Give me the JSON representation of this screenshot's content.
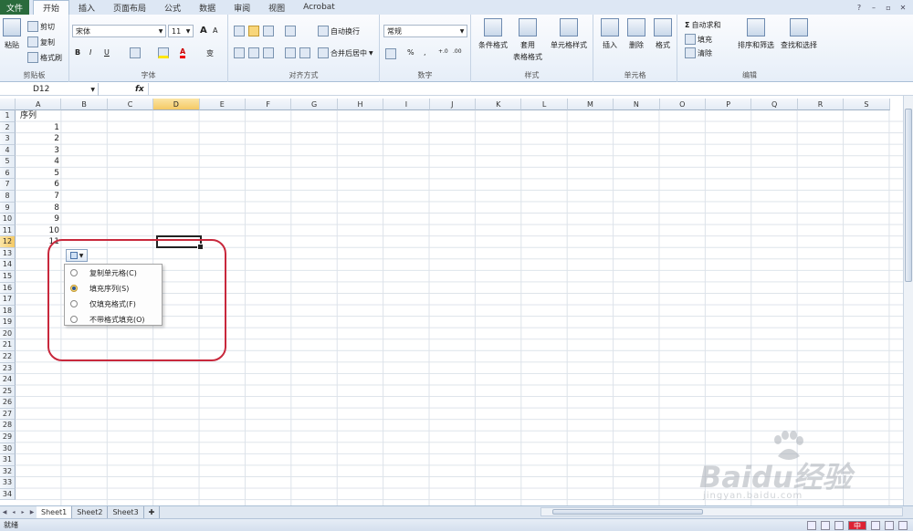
{
  "tabs": {
    "file": "文件",
    "items": [
      "开始",
      "插入",
      "页面布局",
      "公式",
      "数据",
      "审阅",
      "视图",
      "Acrobat"
    ],
    "active_index": 0
  },
  "window_controls": [
    "help-icon",
    "minimize-icon",
    "restore-icon",
    "close-icon"
  ],
  "ribbon": {
    "clipboard": {
      "label": "剪贴板",
      "paste": "粘贴",
      "cut": "剪切",
      "copy": "复制",
      "format_painter": "格式刷"
    },
    "font": {
      "label": "字体",
      "name": "宋体",
      "size": "11",
      "bold": "B",
      "italic": "I",
      "underline": "U",
      "grow": "A",
      "shrink": "A",
      "phonetic": "变"
    },
    "alignment": {
      "label": "对齐方式",
      "wrap": "自动换行",
      "merge": "合并后居中"
    },
    "number": {
      "label": "数字",
      "format": "常规",
      "percent": "%",
      "comma": ",",
      "inc_decimal": "+.0",
      "dec_decimal": ".00"
    },
    "styles": {
      "label": "样式",
      "conditional": "条件格式",
      "table_line1": "套用",
      "table_line2": "表格格式",
      "cell_styles": "单元格样式"
    },
    "cells": {
      "label": "单元格",
      "insert": "插入",
      "delete": "删除",
      "format": "格式"
    },
    "editing": {
      "label": "编辑",
      "autosum": "自动求和",
      "fill": "填充",
      "clear": "清除",
      "sort_filter": "排序和筛选",
      "find_select": "查找和选择"
    }
  },
  "formula_bar": {
    "name_box": "D12",
    "fx": "fx",
    "content": ""
  },
  "columns": [
    "A",
    "B",
    "C",
    "D",
    "E",
    "F",
    "G",
    "H",
    "I",
    "J",
    "K",
    "L",
    "M",
    "N",
    "O",
    "P",
    "Q",
    "R",
    "S"
  ],
  "selected_column": "D",
  "selected_row": 12,
  "rows": [
    "1",
    "2",
    "3",
    "4",
    "5",
    "6",
    "7",
    "8",
    "9",
    "10",
    "11",
    "12",
    "13",
    "14",
    "15",
    "16",
    "17",
    "18",
    "19",
    "20",
    "21",
    "22",
    "23",
    "24",
    "25",
    "26",
    "27",
    "28",
    "29",
    "30",
    "31",
    "32",
    "33",
    "34"
  ],
  "cells": {
    "A1": "序列",
    "A_values": [
      "1",
      "2",
      "3",
      "4",
      "5",
      "6",
      "7",
      "8",
      "9",
      "10",
      "11"
    ]
  },
  "autofill_menu": {
    "options": [
      {
        "label": "复制单元格(C)",
        "checked": false
      },
      {
        "label": "填充序列(S)",
        "checked": true
      },
      {
        "label": "仅填充格式(F)",
        "checked": false
      },
      {
        "label": "不带格式填充(O)",
        "checked": false
      }
    ]
  },
  "sheets": {
    "tabs": [
      "Sheet1",
      "Sheet2",
      "Sheet3"
    ],
    "active_index": 0
  },
  "status": {
    "ready": "就绪",
    "ime": "中"
  },
  "watermark": {
    "brand": "Baidu经验",
    "url": "jingyan.baidu.com"
  },
  "colors": {
    "file_tab": "#2a6b3c",
    "highlight_ring": "#c8283c",
    "selected_header": "#f5c964"
  }
}
